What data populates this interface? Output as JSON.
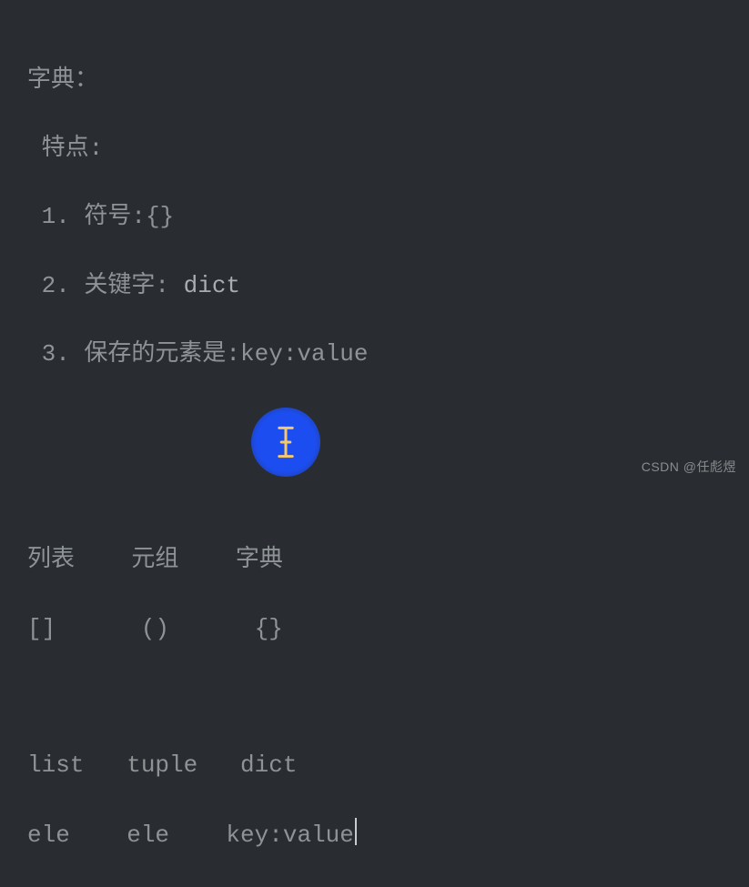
{
  "code": {
    "line1": "字典：",
    "line2": " 特点:",
    "line3": " 1. 符号:{}",
    "line4a": " 2. 关键字: ",
    "line4b": "dict",
    "line5": " 3. 保存的元素是:key:value",
    "line6": "",
    "line7": "",
    "line8": "列表    元组    字典",
    "line9": "[]      ()      {}",
    "line10": "",
    "line11": "list   tuple   dict",
    "line12": "ele    ele    key:value"
  },
  "cursor_icon_name": "text-cursor",
  "pointer_icon_name": "ibeam-cursor-icon",
  "watermark": "CSDN @任彪煜"
}
